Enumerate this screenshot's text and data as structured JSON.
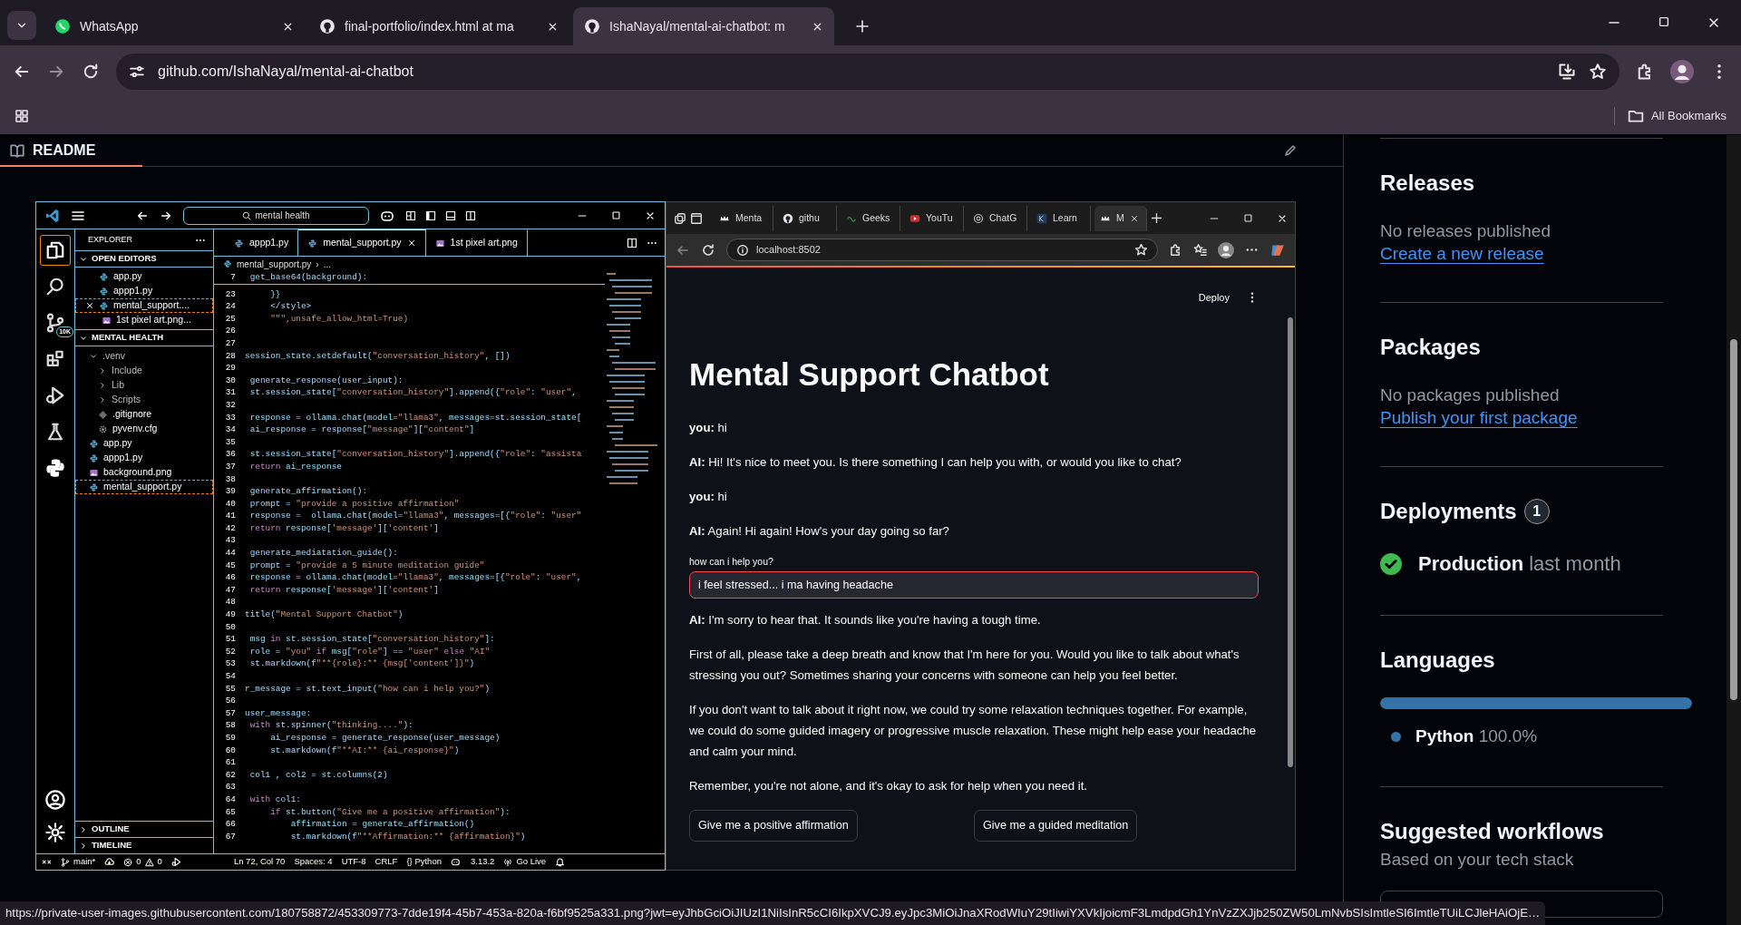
{
  "browser": {
    "tabs": [
      {
        "title": "WhatsApp",
        "kind": "chat",
        "selected": false
      },
      {
        "title": "final-portfolio/index.html at ma",
        "kind": "site",
        "selected": false
      },
      {
        "title": "IshaNayal/mental-ai-chatbot: m",
        "kind": "site",
        "selected": true
      }
    ],
    "address": "github.com/IshaNayal/mental-ai-chatbot",
    "bookmarks_label": "All Bookmarks"
  },
  "readme": {
    "title": "README"
  },
  "vscode": {
    "search": "mental health",
    "activity": [
      {
        "kind": "files",
        "selected": true
      },
      {
        "kind": "search",
        "selected": false
      },
      {
        "kind": "source",
        "selected": false,
        "badge": "10K"
      },
      {
        "kind": "extensions",
        "selected": false
      },
      {
        "kind": "debug",
        "selected": false
      },
      {
        "kind": "flask",
        "selected": false
      },
      {
        "kind": "python",
        "selected": false
      }
    ],
    "explorer_title": "EXPLORER",
    "open_editors": {
      "title": "OPEN EDITORS",
      "expanded": true,
      "items": [
        {
          "label": "app.py",
          "kind": "python",
          "selected": false
        },
        {
          "label": "appp1.py",
          "kind": "python",
          "selected": false
        },
        {
          "label": "mental_support....",
          "kind": "python",
          "selected": true
        },
        {
          "label": "1st pixel art.png...",
          "kind": "image",
          "selected": false
        }
      ]
    },
    "folder": {
      "title": "MENTAL HEALTH",
      "expanded": true,
      "children": [
        {
          "label": ".venv",
          "kind": "folder",
          "expanded": true,
          "selected": false,
          "children": [
            {
              "label": "Include",
              "kind": "folder",
              "expanded": false,
              "selected": false
            },
            {
              "label": "Lib",
              "kind": "folder",
              "expanded": false,
              "selected": false
            },
            {
              "label": "Scripts",
              "kind": "folder",
              "expanded": false,
              "selected": false
            },
            {
              "label": ".gitignore",
              "kind": "git",
              "selected": false
            },
            {
              "label": "pyvenv.cfg",
              "kind": "gear",
              "selected": false
            }
          ]
        },
        {
          "label": "app.py",
          "kind": "python",
          "selected": false
        },
        {
          "label": "appp1.py",
          "kind": "python",
          "selected": false
        },
        {
          "label": "background.png",
          "kind": "image",
          "selected": false
        },
        {
          "label": "mental_support.py",
          "kind": "python",
          "selected": true
        }
      ]
    },
    "panels": [
      {
        "title": "OUTLINE",
        "expanded": false
      },
      {
        "title": "TIMELINE",
        "expanded": false
      }
    ],
    "editor_tabs": [
      {
        "label": "appp1.py",
        "kind": "python",
        "selected": false
      },
      {
        "label": "mental_support.py",
        "kind": "python",
        "selected": true
      },
      {
        "label": "1st pixel art.png",
        "kind": "image",
        "selected": false
      }
    ],
    "breadcrumb": [
      "mental_support.py",
      "›",
      "..."
    ],
    "sticky_line": {
      "n": "7",
      "text": " get_base64(background):"
    },
    "lines": [
      {
        "n": "23",
        "text": "     }}"
      },
      {
        "n": "24",
        "text": "     </style>"
      },
      {
        "n": "25",
        "text": "     \"\"\",unsafe_allow_html=True)"
      },
      {
        "n": "26"
      },
      {
        "n": "27"
      },
      {
        "n": "28",
        "text": "session_state.setdefault(\"conversation_history\", [])"
      },
      {
        "n": "29"
      },
      {
        "n": "30",
        "text": " generate_response(user_input):"
      },
      {
        "n": "31",
        "text": " st.session_state[\"conversation_history\"].append({\"role\": \"user\","
      },
      {
        "n": "32"
      },
      {
        "n": "33",
        "text": " response = ollama.chat(model=\"llama3\", messages=st.session_state["
      },
      {
        "n": "34",
        "text": " ai_response = response[\"message\"][\"content\"]"
      },
      {
        "n": "35"
      },
      {
        "n": "36",
        "text": " st.session_state[\"conversation_history\"].append({\"role\": \"assista"
      },
      {
        "n": "37",
        "text": " return ai_response"
      },
      {
        "n": "38"
      },
      {
        "n": "39",
        "text": " generate_affirmation():"
      },
      {
        "n": "40",
        "text": " prompt = \"provide a positive affirmation\""
      },
      {
        "n": "41",
        "text": " response =  ollama.chat(model=\"llama3\", messages=[{\"role\": \"user\""
      },
      {
        "n": "42",
        "text": " return response['message']['content']"
      },
      {
        "n": "43"
      },
      {
        "n": "44",
        "text": " generate_mediatation_guide():"
      },
      {
        "n": "45",
        "text": " prompt = \"provide a 5 minute meditation guide\""
      },
      {
        "n": "46",
        "text": " response = ollama.chat(model=\"llama3\", messages=[{\"role\": \"user\","
      },
      {
        "n": "47",
        "text": " return response['message']['content']"
      },
      {
        "n": "48"
      },
      {
        "n": "49",
        "text": "title(\"Mental Support Chatbot\")"
      },
      {
        "n": "50"
      },
      {
        "n": "51",
        "text": " msg in st.session_state[\"conversation_history\"]:"
      },
      {
        "n": "52",
        "text": " role = \"you\" if msg[\"role\"] == \"user\" else \"AI\""
      },
      {
        "n": "53",
        "text": " st.markdown(f\"**{role}:** {msg['content']}\")"
      },
      {
        "n": "54"
      },
      {
        "n": "55",
        "text": "r_message = st.text_input(\"how can i help you?\")"
      },
      {
        "n": "56"
      },
      {
        "n": "57",
        "text": "user_message:"
      },
      {
        "n": "58",
        "text": " with st.spinner(\"thinking....\"):"
      },
      {
        "n": "59",
        "text": "     ai_response = generate_response(user_message)"
      },
      {
        "n": "60",
        "text": "     st.markdown(f\"**AI:** {ai_response}\")"
      },
      {
        "n": "61"
      },
      {
        "n": "62",
        "text": " col1 , col2 = st.columns(2)"
      },
      {
        "n": "63"
      },
      {
        "n": "64",
        "text": " with col1:"
      },
      {
        "n": "65",
        "text": "     if st.button(\"Give me a positive affirmation\"):"
      },
      {
        "n": "66",
        "text": "         affirmation = generate_affirmation()"
      },
      {
        "n": "67",
        "text": "         st.markdown(f\"**Affirmation:** {affirmation}\")"
      }
    ],
    "status": {
      "branch": "main*",
      "errors": "0",
      "warnings": "0",
      "position": "Ln 72, Col 70",
      "spaces": "Spaces: 4",
      "encoding": "UTF-8",
      "eol": "CRLF",
      "language": "{} Python",
      "version": "3.13.2",
      "live": "Go Live"
    }
  },
  "app_browser": {
    "tabs": [
      {
        "title": "Menta",
        "kind": "crown",
        "selected": false
      },
      {
        "title": "githu",
        "kind": "site",
        "selected": false
      },
      {
        "title": "Geeks",
        "kind": "geeks",
        "selected": false
      },
      {
        "title": "YouTu",
        "kind": "video",
        "selected": false
      },
      {
        "title": "ChatG",
        "kind": "knot",
        "selected": false
      },
      {
        "title": "Learn",
        "kind": "learn",
        "selected": false
      },
      {
        "title": "M",
        "kind": "crown",
        "selected": true
      }
    ],
    "address": "localhost:8502",
    "deploy": "Deploy",
    "title": "Mental Support Chatbot",
    "messages": [
      "**you:** hi",
      "**AI:** Hi! It's nice to meet you. Is there something I can help you with, or would you like to chat?",
      "**you:** hi",
      "**AI:** Again! Hi again! How's your day going so far?"
    ],
    "input": {
      "label": "how can i help you?",
      "value": "i feel stressed... i ma having headache",
      "focused": true
    },
    "reply": [
      "**AI:** I'm sorry to hear that. It sounds like you're having a tough time.",
      "First of all, please take a deep breath and know that I'm here for you. Would you like to talk about what's stressing you out? Sometimes sharing your concerns with someone can help you feel better.",
      "If you don't want to talk about it right now, we could try some relaxation techniques together. For example, we could do some guided imagery or progressive muscle relaxation. These might help ease your headache and calm your mind.",
      "Remember, you're not alone, and it's okay to ask for help when you need it."
    ],
    "buttons": [
      "Give me a positive affirmation",
      "Give me a guided meditation"
    ]
  },
  "sidebar": {
    "releases": {
      "title": "Releases",
      "text": "No releases published",
      "link": "Create a new release"
    },
    "packages": {
      "title": "Packages",
      "text": "No packages published",
      "link": "Publish your first package"
    },
    "deployments": {
      "title": "Deployments",
      "count": "1",
      "items": [
        {
          "name": "Production",
          "time": "last month",
          "kind": "success"
        }
      ]
    },
    "languages": {
      "title": "Languages",
      "items": [
        {
          "name": "Python",
          "percent": "100.0%",
          "level": 1,
          "color": "#3572a5"
        }
      ]
    },
    "workflows": {
      "title": "Suggested workflows",
      "subtitle": "Based on your tech stack"
    }
  },
  "status_url": "https://private-user-images.githubusercontent.com/180758872/453309773-7dde19f4-45b7-453a-820a-f6bf9525a331.png?jwt=eyJhbGciOiJIUzI1NiIsInR5cCI6IkpXVCJ9.eyJpc3MiOiJnaXRodWIuY29tIiwiYXVkIjoicmF3LmdpdGh1YnVzZXJjb250ZW50LmNvbSIsImtleSI6ImtleTUiLCJleHAiOjE…"
}
